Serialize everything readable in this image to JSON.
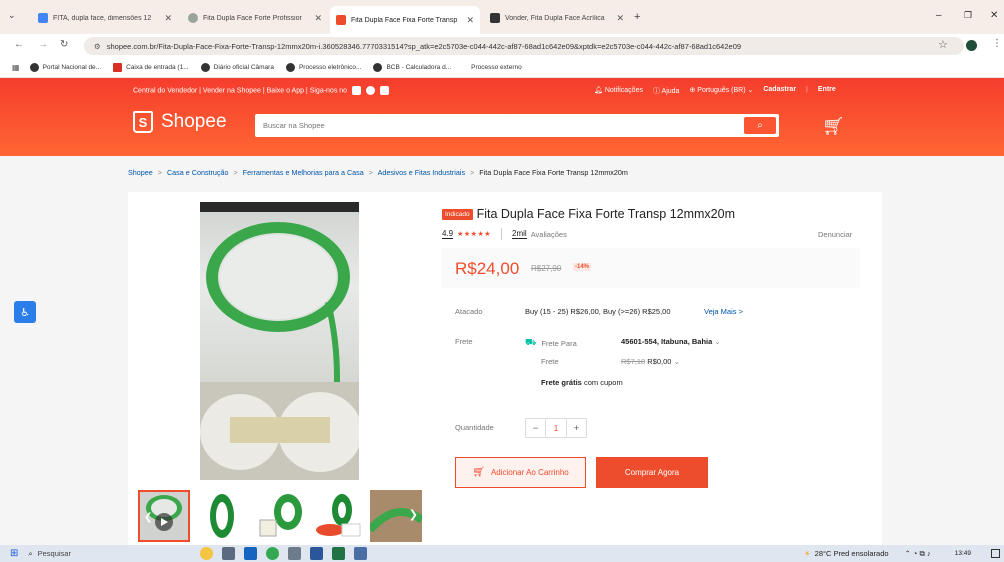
{
  "browser": {
    "tabs": [
      {
        "title": "FITA, dupla face, dimensões 12",
        "color": "#4285f4"
      },
      {
        "title": "Fita Dupla Face Forte Profissior",
        "color": "#9aa59a"
      },
      {
        "title": "Fita Dupla Face Fixa Forte Transp",
        "color": "#ee4d2d",
        "active": true
      },
      {
        "title": "Vonder, Fita Dupla Face Acrílica",
        "color": "#333"
      }
    ],
    "new_tab": "+",
    "url": "shopee.com.br/Fita-Dupla-Face-Fixa-Forte-Transp-12mmx20m-i.360528346.7770331514?sp_atk=e2c5703e-c044-442c-af87-68ad1c642e09&xptdk=e2c5703e-c044-442c-af87-68ad1c642e09",
    "bookmarks": [
      "Portal Nacional de...",
      "Caixa de entrada (1...",
      "Diário oficial Câmara",
      "Processo eletrônico...",
      "BCB - Calculadora d...",
      "Processo externo"
    ]
  },
  "header": {
    "seller_links": "Central do Vendedor  |  Vender na Shopee  |  Baixe o App  |  Siga-nos no",
    "notifications": "Notificações",
    "help": "Ajuda",
    "language": "Português (BR)",
    "register": "Cadastrar",
    "login": "Entre",
    "logo": "Shopee",
    "search_placeholder": "Buscar na Shopee"
  },
  "breadcrumb": {
    "items": [
      "Shopee",
      "Casa e Construção",
      "Ferramentas e Melhorias para a Casa",
      "Adesivos e Fitas Industriais"
    ],
    "sep": ">",
    "current": "Fita Dupla Face Fixa Forte Transp 12mmx20m"
  },
  "product": {
    "badge": "Indicado",
    "title": "Fita Dupla Face Fixa Forte Transp 12mmx20m",
    "rating": "4.9",
    "stars": "★★★★★",
    "reviews_count": "2mil",
    "reviews_label": "Avaliações",
    "report": "Denunciar",
    "price": "R$24,00",
    "old_price": "R$27,90",
    "discount": "-14%",
    "wholesale_label": "Atacado",
    "wholesale_value": "Buy (15 - 25) R$26,00, Buy (>=26) R$25,00",
    "see_more": "Veja Mais >",
    "shipping_label": "Frete",
    "shipping_to_label": "Frete Para",
    "shipping_location": "45601-554, Itabuna, Bahia",
    "freight_label": "Frete",
    "freight_old": "R$7,18",
    "freight_new": "R$0,00",
    "free_shipping_bold": "Frete grátis",
    "free_shipping_rest": "com cupom",
    "quantity_label": "Quantidade",
    "quantity_minus": "−",
    "quantity_value": "1",
    "quantity_plus": "+",
    "add_to_cart": "Adicionar Ao Carrinho",
    "buy_now": "Comprar Agora"
  },
  "taskbar": {
    "search": "Pesquisar",
    "weather": "28°C  Pred ensolarado",
    "time": "13:49"
  }
}
